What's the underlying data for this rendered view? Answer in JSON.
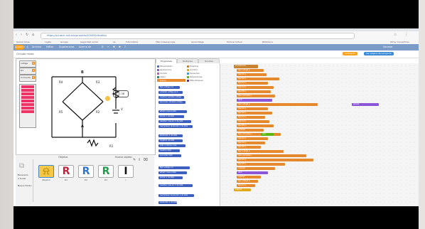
{
  "browser": {
    "url": "https://scratch.mit.edu/projects/000000/#editor",
    "bookmarks": [
      "Aplicaciones",
      "Inglés",
      "Google",
      "Seguridad social",
      "La",
      "Informática",
      "http://www.google",
      "Aprendizaje",
      "Tutorial Virtual",
      "Biblioteca",
      "Otros marcadores"
    ]
  },
  "scratch_menu": {
    "logo": "SCRATCH",
    "items": [
      "Archivo",
      "Editar",
      "Sugerencias",
      "Acerca de"
    ],
    "user": "Usuario",
    "project_title": "Circuito mixto",
    "btn_share": "Compartir",
    "btn_project_page": "Ver página del proyecto"
  },
  "stage": {
    "monitor1_label": "voltaje",
    "monitor1_value": "0",
    "monitor2_label": "R1",
    "monitor2_value": "0",
    "monitor3_label": "Corriente",
    "monitor3_value": "0",
    "speech": "11.38",
    "circuit": {
      "B": "B",
      "A": "A",
      "R1": "R1",
      "R2": "R2",
      "R3": "R3",
      "R4": "R4",
      "R5": "R5",
      "V": "V"
    }
  },
  "sprites_panel": {
    "title": "Objetos",
    "new_object": "Nuevo objeto:",
    "stage_label": "Escenario",
    "stage_sub": "1 fondo",
    "new_bg": "Nuevo fondo:",
    "sprites": [
      {
        "glyph": "",
        "label": "Objeto1"
      },
      {
        "glyph": "R",
        "label": "R1"
      },
      {
        "glyph": "R",
        "label": "R2"
      },
      {
        "glyph": "R",
        "label": "R3"
      },
      {
        "glyph": "I",
        "label": "I"
      }
    ]
  },
  "tabs": [
    "Programas",
    "Disfraces",
    "Sonidos"
  ],
  "categories": [
    "Movimiento",
    "Apariencia",
    "Sonido",
    "Lápiz",
    "Datos",
    "Eventos",
    "Control",
    "Sensores",
    "Operadores",
    "Más bloques"
  ],
  "category_colors": [
    "#4a6cd4",
    "#8a55d7",
    "#c94fc6",
    "#0e9a6c",
    "#e6882c",
    "#c88330",
    "#e1a91a",
    "#2ca5e2",
    "#5cb712",
    "#632d99"
  ],
  "palette_blocks": [
    "fijar voltaje a 0",
    "cambiar voltaje en 1",
    "mostrar variable voltaje",
    "esconder variable voltaje",
    "añadir cosa a lista",
    "borrar 1 de lista",
    "insertar cosa en 1 de lista",
    "reemplazar elemento 1 de lista",
    "elemento 1 de lista",
    "longitud de lista",
    "lista contiene cosa",
    "mostrar lista",
    "esconder lista"
  ],
  "script_blocks": [
    "al presionar",
    "fijar voltaje a",
    "fijar R1 a",
    "fijar R2 a",
    "fijar R3 a",
    "fijar R4 a",
    "fijar R5 a",
    "decir",
    "esperar",
    "fijar corriente a",
    "unir",
    "pensar",
    "cambiar"
  ],
  "zoom": "= -"
}
